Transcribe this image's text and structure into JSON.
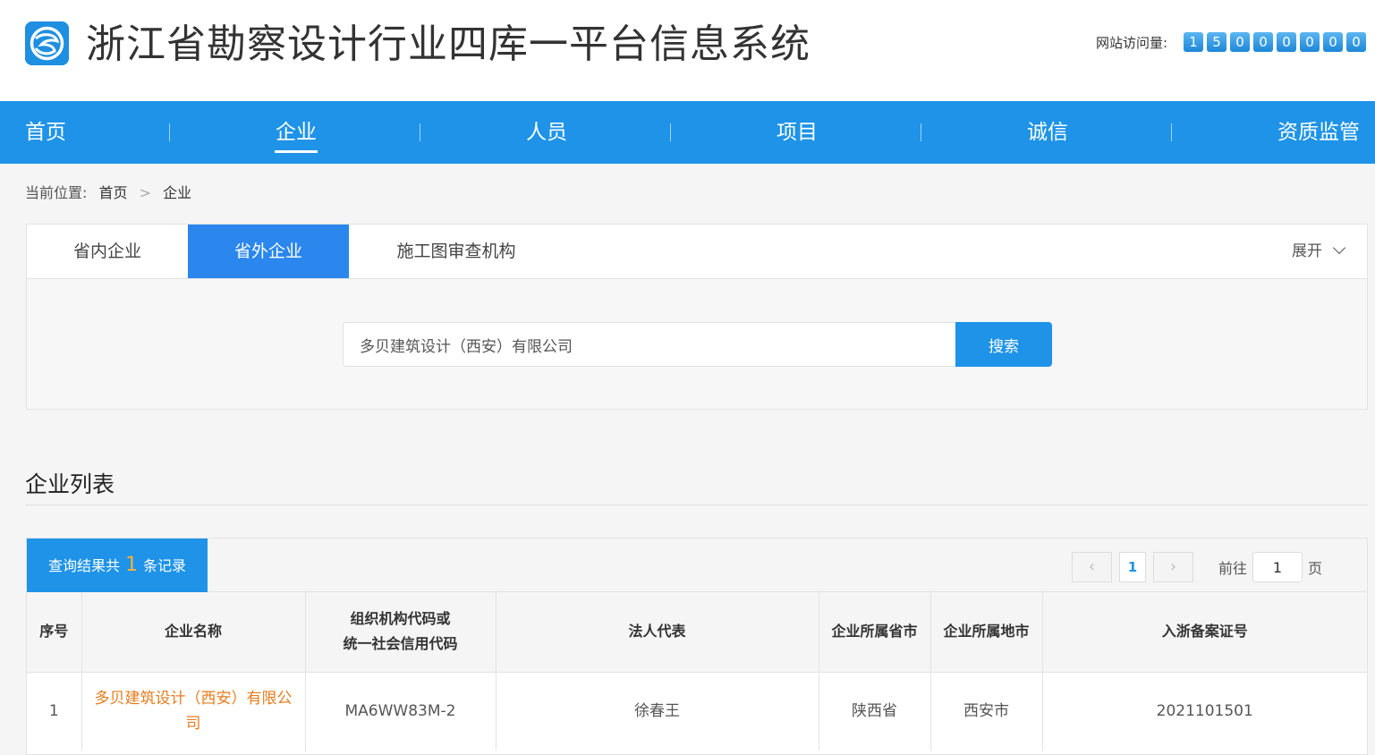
{
  "header": {
    "title": "浙江省勘察设计行业四库一平台信息系统",
    "logo_icon": "globe-swirl-icon",
    "visits_label": "网站访问量:",
    "visits_digits": [
      "1",
      "5",
      "0",
      "0",
      "0",
      "0",
      "0",
      "0"
    ]
  },
  "nav": {
    "items": [
      {
        "label": "首页"
      },
      {
        "label": "企业"
      },
      {
        "label": "人员"
      },
      {
        "label": "项目"
      },
      {
        "label": "诚信"
      },
      {
        "label": "资质监管"
      }
    ],
    "active": "企业"
  },
  "breadcrumb": {
    "prefix": "当前位置:",
    "items": [
      "首页",
      "企业"
    ],
    "separator": ">"
  },
  "search_panel": {
    "tabs": [
      {
        "label": "省内企业"
      },
      {
        "label": "省外企业"
      },
      {
        "label": "施工图审查机构"
      }
    ],
    "active_tab": "省外企业",
    "expand_label": "展开",
    "search_value": "多贝建筑设计（西安）有限公司",
    "search_button": "搜索"
  },
  "list": {
    "title": "企业列表",
    "result_prefix": "查询结果共",
    "result_count": "1",
    "result_suffix": "条记录",
    "pager": {
      "current_page": "1",
      "goto_label": "前往",
      "goto_value": "1",
      "goto_unit": "页"
    },
    "columns": {
      "index": "序号",
      "name": "企业名称",
      "code_line1": "组织机构代码或",
      "code_line2": "统一社会信用代码",
      "legal_rep": "法人代表",
      "province": "企业所属省市",
      "city": "企业所属地市",
      "record_no": "入浙备案证号"
    },
    "rows": [
      {
        "index": "1",
        "name": "多贝建筑设计（西安）有限公司",
        "code": "MA6WW83M-2",
        "legal_rep": "徐春王",
        "province": "陕西省",
        "city": "西安市",
        "record_no": "2021101501"
      }
    ]
  },
  "colors": {
    "primary": "#1e93e8",
    "tab_active": "#2b87ee",
    "link_orange": "#e87b1c",
    "count_highlight": "#f6b13a"
  }
}
